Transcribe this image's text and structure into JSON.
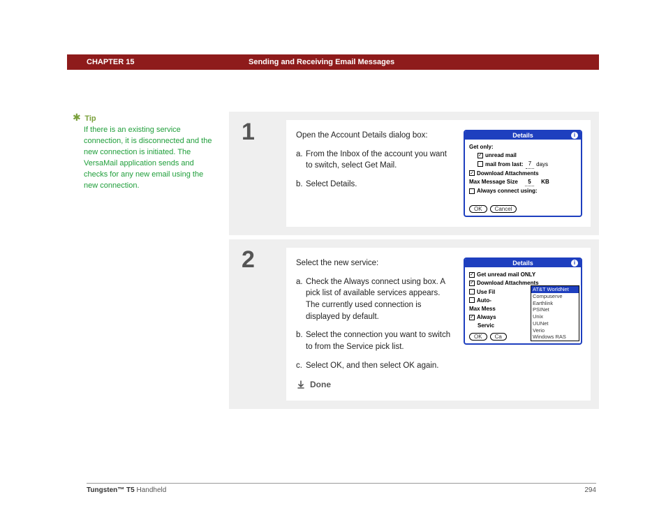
{
  "header": {
    "chapter": "CHAPTER 15",
    "title": "Sending and Receiving Email Messages"
  },
  "tip": {
    "label": "Tip",
    "text": "If there is an existing service connection, it is disconnected and the new connection is initiated. The VersaMail application sends and checks for any new email using the new connection."
  },
  "steps": [
    {
      "num": "1",
      "intro": "Open the Account Details dialog box:",
      "items": [
        {
          "lbl": "a.",
          "text": "From the Inbox of the account you want to switch, select Get Mail."
        },
        {
          "lbl": "b.",
          "text": "Select Details."
        }
      ],
      "dialog": {
        "title": "Details",
        "get_only": "Get only:",
        "unread": "unread mail",
        "mail_from_last": "mail from last:",
        "days_val": "7",
        "days_label": "days",
        "download_att": "Download Attachments",
        "max_msg": "Max Message Size",
        "kb_val": "5",
        "kb_label": "KB",
        "always": "Always connect using:",
        "ok": "OK",
        "cancel": "Cancel"
      }
    },
    {
      "num": "2",
      "intro": "Select the new service:",
      "items": [
        {
          "lbl": "a.",
          "text": "Check the Always connect using box. A pick list of available services appears. The currently used connection is displayed by default."
        },
        {
          "lbl": "b.",
          "text": "Select the connection you want to switch to from the Service pick list."
        },
        {
          "lbl": "c.",
          "text": "Select OK, and then select OK again."
        }
      ],
      "done": "Done",
      "dialog": {
        "title": "Details",
        "get_unread_only": "Get unread mail ONLY",
        "download_att": "Download Attachments",
        "use_fil": "Use Fil",
        "auto": "Auto-",
        "max_mess": "Max Mess",
        "always": "Always",
        "service": "Servic",
        "ok": "OK",
        "cancel_partial": "Ca",
        "options": [
          "AT&T WorldNet",
          "Compuserve",
          "Earthlink",
          "PSINet",
          "Unix",
          "UUNet",
          "Verio",
          "Windows RAS"
        ]
      }
    }
  ],
  "footer": {
    "product_bold": "Tungsten™ T5",
    "product_rest": " Handheld",
    "page": "294"
  }
}
